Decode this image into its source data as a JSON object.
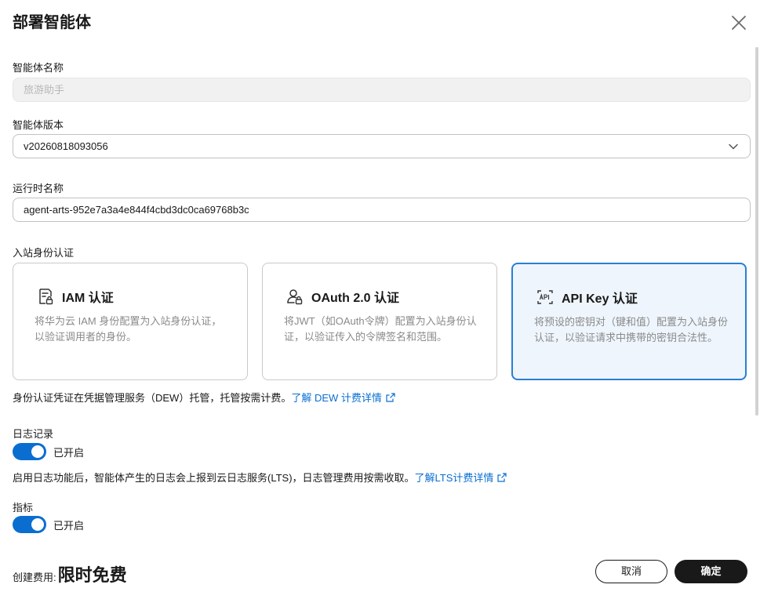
{
  "dialog": {
    "title": "部署智能体"
  },
  "form": {
    "agent_name": {
      "label": "智能体名称",
      "value": "旅游助手"
    },
    "agent_version": {
      "label": "智能体版本",
      "value": "v20260818093056"
    },
    "runtime_name": {
      "label": "运行时名称",
      "value": "agent-arts-952e7a3a4e844f4cbd3dc0ca69768b3c"
    },
    "inbound_auth": {
      "label": "入站身份认证",
      "options": [
        {
          "title": "IAM 认证",
          "desc": "将华为云 IAM 身份配置为入站身份认证，以验证调用者的身份。",
          "icon": "iam-doc-icon",
          "selected": false
        },
        {
          "title": "OAuth 2.0 认证",
          "desc": "将JWT（如OAuth令牌）配置为入站身份认证，以验证传入的令牌签名和范围。",
          "icon": "oauth-user-lock-icon",
          "selected": false
        },
        {
          "title": "API Key 认证",
          "desc": "将预设的密钥对（键和值）配置为入站身份认证，以验证请求中携带的密钥合法性。",
          "icon": "api-key-icon",
          "selected": true
        }
      ],
      "note": "身份认证凭证在凭据管理服务（DEW）托管，托管按需计费。",
      "note_link": "了解 DEW 计费详情"
    },
    "logging": {
      "label": "日志记录",
      "state": "已开启",
      "note": "启用日志功能后，智能体产生的日志会上报到云日志服务(LTS)，日志管理费用按需收取。",
      "note_link": "了解LTS计费详情"
    },
    "metrics": {
      "label": "指标",
      "state": "已开启"
    }
  },
  "footer": {
    "fee_label": "创建费用:",
    "fee_value": "限时免费",
    "cancel_label": "取消",
    "confirm_label": "确定"
  },
  "colors": {
    "accent": "#0a6ed1",
    "selected_border": "#2a7ed2",
    "selected_bg": "#eef5fd",
    "primary_button": "#191919"
  }
}
